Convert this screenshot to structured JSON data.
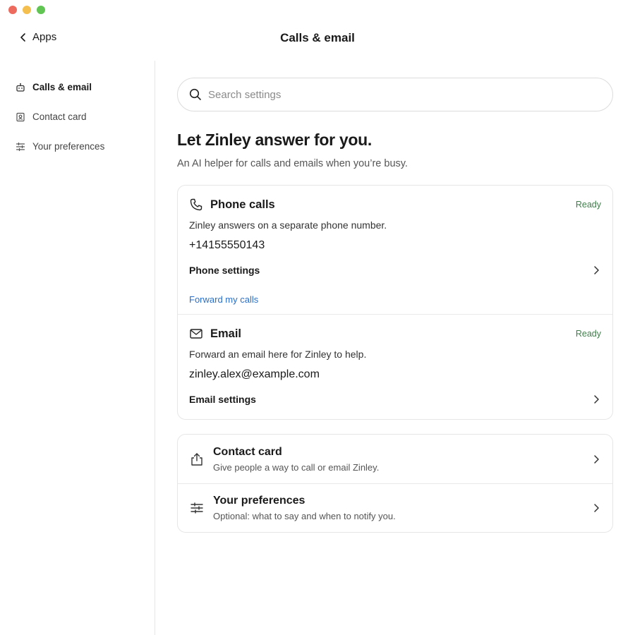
{
  "window": {
    "title": "Calls & email"
  },
  "nav": {
    "back_label": "Apps"
  },
  "sidebar": {
    "items": [
      {
        "label": "Calls & email",
        "icon": "robot-icon"
      },
      {
        "label": "Contact card",
        "icon": "contact-card-icon"
      },
      {
        "label": "Your preferences",
        "icon": "sliders-icon"
      }
    ]
  },
  "search": {
    "placeholder": "Search settings"
  },
  "hero": {
    "title": "Let Zinley answer for you.",
    "subtitle": "An AI helper for calls and emails when you’re busy."
  },
  "phone": {
    "title": "Phone calls",
    "status": "Ready",
    "description": "Zinley answers on a separate phone number.",
    "number": "+14155550143",
    "settings_label": "Phone settings",
    "link_label": "Forward my calls"
  },
  "email": {
    "title": "Email",
    "status": "Ready",
    "description": "Forward an email here for Zinley to help.",
    "address": "zinley.alex@example.com",
    "settings_label": "Email settings"
  },
  "extras": {
    "contact": {
      "title": "Contact card",
      "description": "Give people a way to call or email Zinley."
    },
    "preferences": {
      "title": "Your preferences",
      "description": "Optional: what to say and when to notify you."
    }
  },
  "colors": {
    "status_ready": "#3f7d4a",
    "link": "#2a6fc9"
  }
}
